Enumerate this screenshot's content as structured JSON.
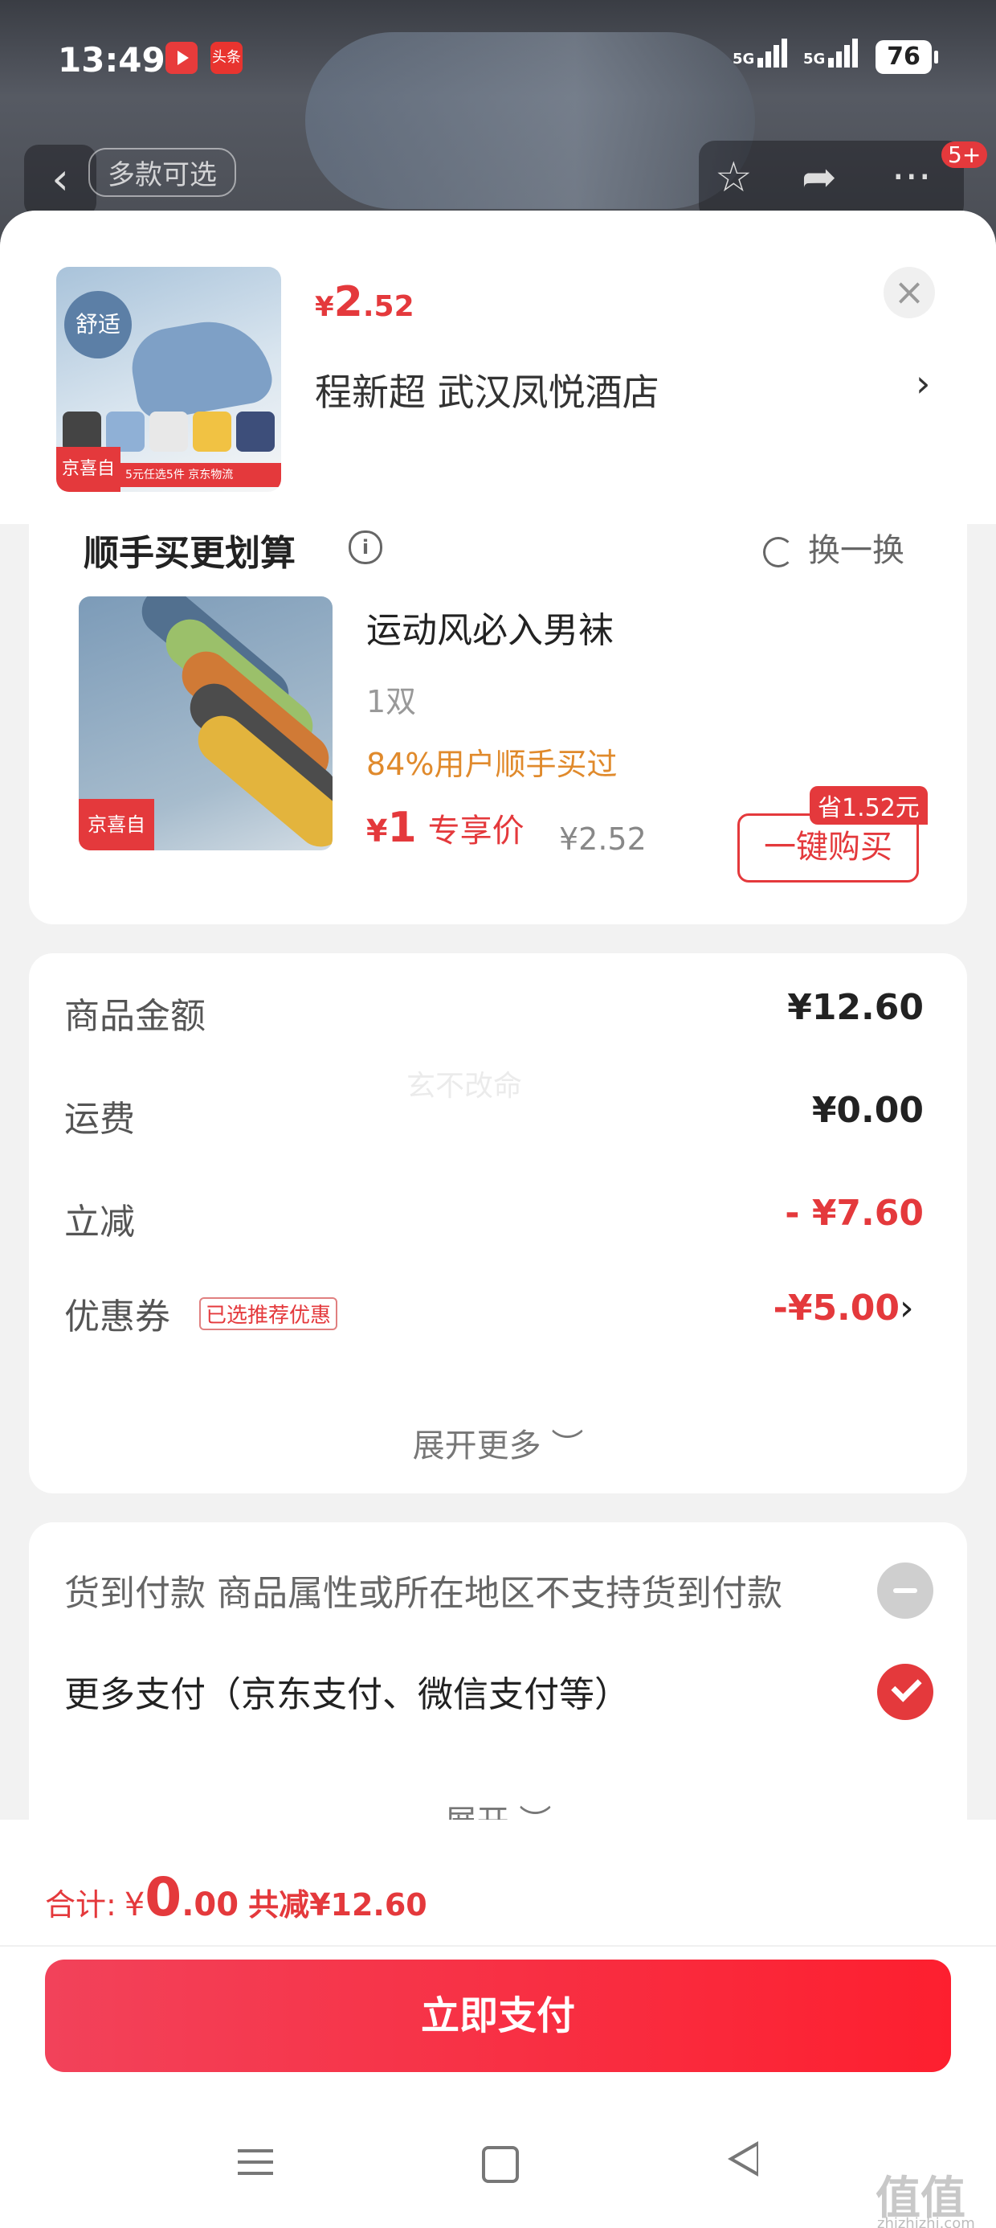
{
  "status_bar": {
    "time": "13:49",
    "news_app_label": "头条",
    "signal1": "5G",
    "signal2": "5G",
    "battery": "76"
  },
  "background_page": {
    "variant_pill": "多款可选",
    "cart_badge": "5+"
  },
  "sheet_header": {
    "thumb_badge": "舒适",
    "thumb_tag": "京喜自营 包邮",
    "thumb_strip": "5元任选5件 京东物流",
    "price": {
      "currency": "¥",
      "integer": "2",
      "decimal": ".52"
    },
    "address": "程新超  武汉凤悦酒店",
    "close_icon": "close-icon"
  },
  "addon": {
    "title": "顺手买更划算",
    "swap_label": "换一换",
    "product_name": "运动风必入男袜",
    "quantity": "1双",
    "buyers": "84%用户顺手买过",
    "price": {
      "currency": "¥",
      "integer": "1",
      "label": "专享价"
    },
    "original_price": "¥2.52",
    "save_tag": "省1.52元",
    "buy_button": "一键购买",
    "image_tag": "京喜自营 包邮"
  },
  "summary": {
    "rows": [
      {
        "label": "商品金额",
        "value": "¥12.60",
        "red": false
      },
      {
        "label": "运费",
        "value": "¥0.00",
        "red": false
      },
      {
        "label": "立减",
        "value": "- ¥7.60",
        "red": true
      }
    ],
    "coupon": {
      "label": "优惠券",
      "tag": "已选推荐优惠",
      "value": "-¥5.00"
    },
    "watermark": "玄不改命",
    "expand_more": "展开更多 ︶"
  },
  "payment": {
    "cod": "货到付款 商品属性或所在地区不支持货到付款",
    "more": "更多支付（京东支付、微信支付等）",
    "expand": "展开 ︶"
  },
  "bottom": {
    "total_label": "合计:",
    "total": {
      "currency": "¥",
      "integer": "0",
      "decimal": ".00"
    },
    "saved": "共减¥12.60",
    "pay_button": "立即支付",
    "site_watermark": "值值值",
    "site_watermark_url": "zhizhizhi.com"
  },
  "colors": {
    "accent": "#e4393c",
    "orange": "#e08a2c"
  }
}
